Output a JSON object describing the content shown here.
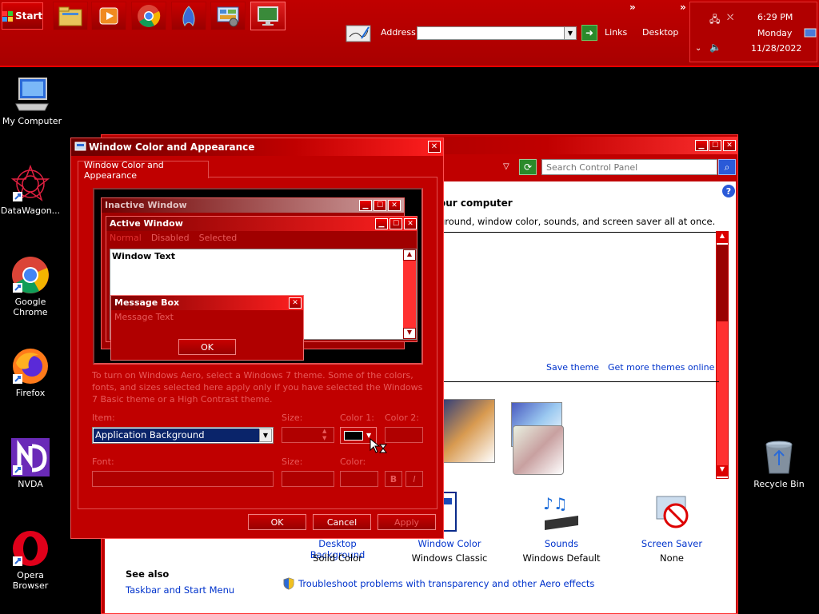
{
  "taskbar": {
    "start_label": "Start",
    "address_label": "Address",
    "address_value": "",
    "links_label": "Links",
    "desktop_label": "Desktop",
    "clock_time": "6:29 PM",
    "clock_day": "Monday",
    "clock_date": "11/28/2022"
  },
  "desktop_icons": [
    {
      "label": "My Computer"
    },
    {
      "label": "DataWagon..."
    },
    {
      "label": "Google Chrome"
    },
    {
      "label": "Firefox"
    },
    {
      "label": "NVDA"
    },
    {
      "label": "Opera Browser"
    },
    {
      "label": "Recycle Bin"
    }
  ],
  "control_panel": {
    "search_placeholder": "Search Control Panel",
    "heading_fragment": "our computer",
    "subtext_fragment": "ground, window color, sounds, and screen saver all at once.",
    "save_theme": "Save theme",
    "get_more_themes": "Get more themes online",
    "desktop_background_label": "Desktop Background",
    "desktop_background_value": "Solid Color",
    "window_color_label": "Window Color",
    "window_color_value": "Windows Classic",
    "sounds_label": "Sounds",
    "sounds_value": "Windows Default",
    "screensaver_label": "Screen Saver",
    "screensaver_value": "None",
    "see_also": "See also",
    "taskbar_link": "Taskbar and Start Menu",
    "troubleshoot_link": "Troubleshoot problems with transparency and other Aero effects"
  },
  "dialog": {
    "title": "Window Color and Appearance",
    "tab_label": "Window Color and Appearance",
    "preview": {
      "inactive_title": "Inactive Window",
      "active_title": "Active Window",
      "menu_normal": "Normal",
      "menu_disabled": "Disabled",
      "menu_selected": "Selected",
      "window_text": "Window Text",
      "msgbox_title": "Message Box",
      "msgbox_text": "Message Text",
      "msgbox_ok": "OK"
    },
    "info_text": "To turn on Windows Aero, select a Windows 7 theme.  Some of the colors, fonts, and sizes selected here apply only if you have selected the Windows 7 Basic theme or a High Contrast theme.",
    "item_label": "Item:",
    "item_value": "Application Background",
    "size_label": "Size:",
    "color1_label": "Color 1:",
    "color2_label": "Color 2:",
    "font_label": "Font:",
    "font_size_label": "Size:",
    "font_color_label": "Color:",
    "bold_label": "B",
    "italic_label": "I",
    "ok": "OK",
    "cancel": "Cancel",
    "apply": "Apply"
  },
  "colors": {
    "accent_red": "#c00000",
    "title_red": "#ff2020",
    "selection_blue": "#0a246a"
  }
}
